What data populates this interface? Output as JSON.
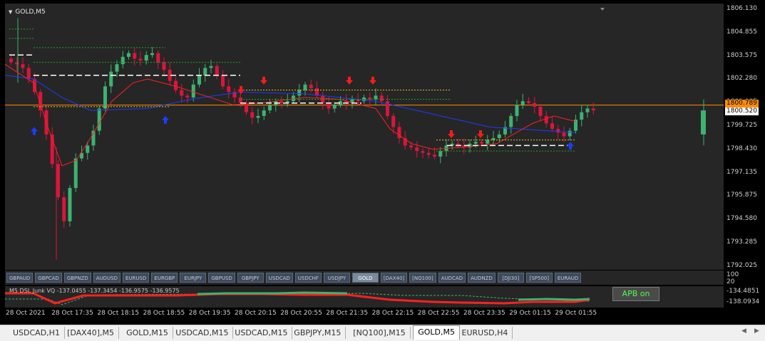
{
  "chart": {
    "symbol_title": "GOLD,M5",
    "price_ticks": [
      "1806.130",
      "1804.855",
      "1803.575",
      "1802.280",
      "1801.005",
      "1799.725",
      "1798.430",
      "1797.135",
      "1795.875",
      "1794.580",
      "1793.285",
      "1792.025"
    ],
    "price_tag_orange": "1800.789",
    "price_tag_current": "1800.520",
    "colors": {
      "bull_candle": "#3cb371",
      "bear_candle": "#dc143c",
      "ma_blue": "#1e3cff",
      "ma_red": "#ff2020",
      "level_orange": "#ff8c00",
      "arrow_up": "#1e3cff",
      "arrow_down": "#ff1a1a",
      "dotted_yellow": "#e0c020",
      "dotted_green": "#20a020"
    }
  },
  "symbol_buttons": [
    "GBPAUD",
    "GBPCAD",
    "GBPNZD",
    "AUDUSD",
    "EURUSD",
    "EURGBP",
    "EURJPY",
    "GBPUSD",
    "GBPJPY",
    "USDCAD",
    "USDCHF",
    "USDJPY",
    "GOLD",
    "[DAX40]",
    "[NQ100]",
    "AUDCAD",
    "AUDNZD",
    "[DJI30]",
    "[SP500]",
    "EURAUD"
  ],
  "active_symbol": "GOLD",
  "indicator": {
    "label": "M5 DSL Junk VQ -137.0455 -137.3454 -136.9575 -136.9575",
    "apb_label": "APB on",
    "axis_ticks": [
      "100",
      "20",
      "-134.4851",
      "-138.0934"
    ]
  },
  "time_labels": [
    "28 Oct 2021",
    "28 Oct 17:35",
    "28 Oct 18:15",
    "28 Oct 18:55",
    "28 Oct 19:35",
    "28 Oct 20:15",
    "28 Oct 20:55",
    "28 Oct 21:35",
    "28 Oct 22:15",
    "28 Oct 22:55",
    "28 Oct 23:35",
    "29 Oct 01:15",
    "29 Oct 01:55"
  ],
  "tabs": [
    "USDCAD,H1",
    "[DAX40],M5",
    "GOLD,M15",
    "USDCAD,M15",
    "USDCAD,M15",
    "GBPJPY,M15",
    "[NQ100],M15",
    "GOLD,M5",
    "EURUSD,H4"
  ],
  "active_tab": "GOLD,M5"
}
